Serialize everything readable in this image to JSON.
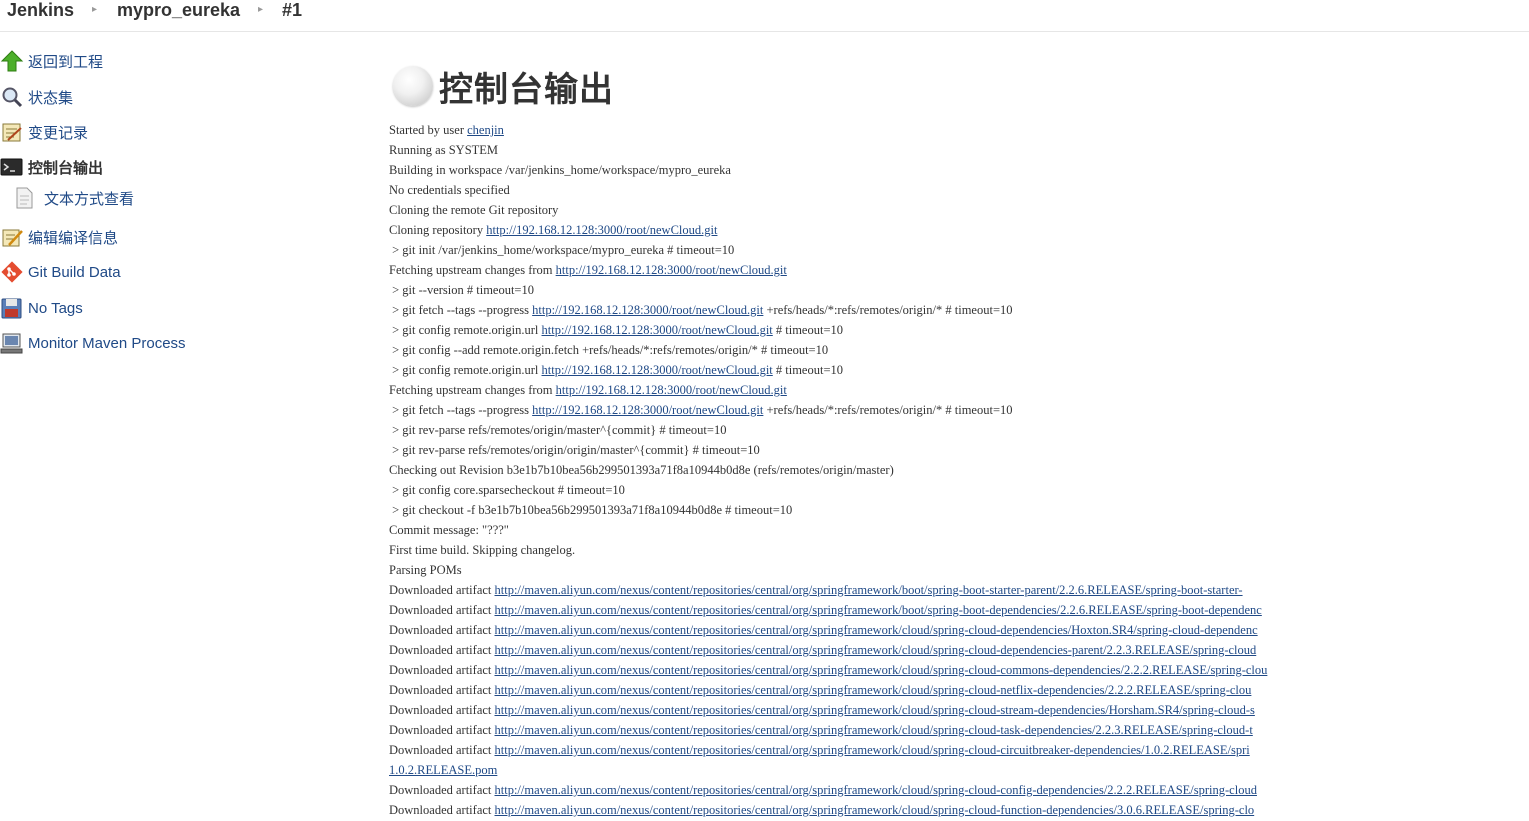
{
  "breadcrumbs": [
    {
      "label": "Jenkins"
    },
    {
      "label": "mypro_eureka"
    },
    {
      "label": "#1"
    }
  ],
  "sidebar": {
    "items": [
      {
        "label": "返回到工程",
        "icon": "up-arrow-icon"
      },
      {
        "label": "状态集",
        "icon": "magnifier-icon"
      },
      {
        "label": "变更记录",
        "icon": "notepad-icon"
      },
      {
        "label": "控制台输出",
        "icon": "terminal-icon",
        "active": true
      },
      {
        "label": "文本方式查看",
        "icon": "document-icon"
      },
      {
        "label": "编辑编译信息",
        "icon": "edit-icon"
      },
      {
        "label": "Git Build Data",
        "icon": "git-icon"
      },
      {
        "label": "No Tags",
        "icon": "save-icon"
      },
      {
        "label": "Monitor Maven Process",
        "icon": "computer-icon"
      }
    ]
  },
  "main": {
    "title": "控制台输出",
    "status": "not-built",
    "console_lines": [
      {
        "pre": "Started by user ",
        "link": "chenjin",
        "post": ""
      },
      {
        "pre": "Running as SYSTEM"
      },
      {
        "pre": "Building in workspace /var/jenkins_home/workspace/mypro_eureka"
      },
      {
        "pre": "No credentials specified"
      },
      {
        "pre": "Cloning the remote Git repository"
      },
      {
        "pre": "Cloning repository ",
        "link": "http://192.168.12.128:3000/root/newCloud.git",
        "post": ""
      },
      {
        "pre": " > git init /var/jenkins_home/workspace/mypro_eureka # timeout=10"
      },
      {
        "pre": "Fetching upstream changes from ",
        "link": "http://192.168.12.128:3000/root/newCloud.git",
        "post": ""
      },
      {
        "pre": " > git --version # timeout=10"
      },
      {
        "pre": " > git fetch --tags --progress ",
        "link": "http://192.168.12.128:3000/root/newCloud.git",
        "post": " +refs/heads/*:refs/remotes/origin/* # timeout=10"
      },
      {
        "pre": " > git config remote.origin.url ",
        "link": "http://192.168.12.128:3000/root/newCloud.git",
        "post": " # timeout=10"
      },
      {
        "pre": " > git config --add remote.origin.fetch +refs/heads/*:refs/remotes/origin/* # timeout=10"
      },
      {
        "pre": " > git config remote.origin.url ",
        "link": "http://192.168.12.128:3000/root/newCloud.git",
        "post": " # timeout=10"
      },
      {
        "pre": "Fetching upstream changes from ",
        "link": "http://192.168.12.128:3000/root/newCloud.git",
        "post": ""
      },
      {
        "pre": " > git fetch --tags --progress ",
        "link": "http://192.168.12.128:3000/root/newCloud.git",
        "post": " +refs/heads/*:refs/remotes/origin/* # timeout=10"
      },
      {
        "pre": " > git rev-parse refs/remotes/origin/master^{commit} # timeout=10"
      },
      {
        "pre": " > git rev-parse refs/remotes/origin/origin/master^{commit} # timeout=10"
      },
      {
        "pre": "Checking out Revision b3e1b7b10bea56b299501393a71f8a10944b0d8e (refs/remotes/origin/master)"
      },
      {
        "pre": " > git config core.sparsecheckout # timeout=10"
      },
      {
        "pre": " > git checkout -f b3e1b7b10bea56b299501393a71f8a10944b0d8e # timeout=10"
      },
      {
        "pre": "Commit message: \"???\""
      },
      {
        "pre": "First time build. Skipping changelog."
      },
      {
        "pre": "Parsing POMs"
      },
      {
        "pre": "Downloaded artifact ",
        "link": "http://maven.aliyun.com/nexus/content/repositories/central/org/springframework/boot/spring-boot-starter-parent/2.2.6.RELEASE/spring-boot-starter-",
        "post": ""
      },
      {
        "pre": "Downloaded artifact ",
        "link": "http://maven.aliyun.com/nexus/content/repositories/central/org/springframework/boot/spring-boot-dependencies/2.2.6.RELEASE/spring-boot-dependenc",
        "post": ""
      },
      {
        "pre": "Downloaded artifact ",
        "link": "http://maven.aliyun.com/nexus/content/repositories/central/org/springframework/cloud/spring-cloud-dependencies/Hoxton.SR4/spring-cloud-dependenc",
        "post": ""
      },
      {
        "pre": "Downloaded artifact ",
        "link": "http://maven.aliyun.com/nexus/content/repositories/central/org/springframework/cloud/spring-cloud-dependencies-parent/2.2.3.RELEASE/spring-cloud",
        "post": ""
      },
      {
        "pre": "Downloaded artifact ",
        "link": "http://maven.aliyun.com/nexus/content/repositories/central/org/springframework/cloud/spring-cloud-commons-dependencies/2.2.2.RELEASE/spring-clou",
        "post": ""
      },
      {
        "pre": "Downloaded artifact ",
        "link": "http://maven.aliyun.com/nexus/content/repositories/central/org/springframework/cloud/spring-cloud-netflix-dependencies/2.2.2.RELEASE/spring-clou",
        "post": ""
      },
      {
        "pre": "Downloaded artifact ",
        "link": "http://maven.aliyun.com/nexus/content/repositories/central/org/springframework/cloud/spring-cloud-stream-dependencies/Horsham.SR4/spring-cloud-s",
        "post": ""
      },
      {
        "pre": "Downloaded artifact ",
        "link": "http://maven.aliyun.com/nexus/content/repositories/central/org/springframework/cloud/spring-cloud-task-dependencies/2.2.3.RELEASE/spring-cloud-t",
        "post": ""
      },
      {
        "pre": "Downloaded artifact ",
        "link": "http://maven.aliyun.com/nexus/content/repositories/central/org/springframework/cloud/spring-cloud-circuitbreaker-dependencies/1.0.2.RELEASE/spri",
        "post": ""
      },
      {
        "pre": "",
        "link": "1.0.2.RELEASE.pom",
        "post": ""
      },
      {
        "pre": "Downloaded artifact ",
        "link": "http://maven.aliyun.com/nexus/content/repositories/central/org/springframework/cloud/spring-cloud-config-dependencies/2.2.2.RELEASE/spring-cloud",
        "post": ""
      },
      {
        "pre": "Downloaded artifact ",
        "link": "http://maven.aliyun.com/nexus/content/repositories/central/org/springframework/cloud/spring-cloud-function-dependencies/3.0.6.RELEASE/spring-clo",
        "post": ""
      }
    ]
  },
  "colors": {
    "link": "#204a87",
    "text": "#333333",
    "status_ball": "#e0e0e0"
  }
}
